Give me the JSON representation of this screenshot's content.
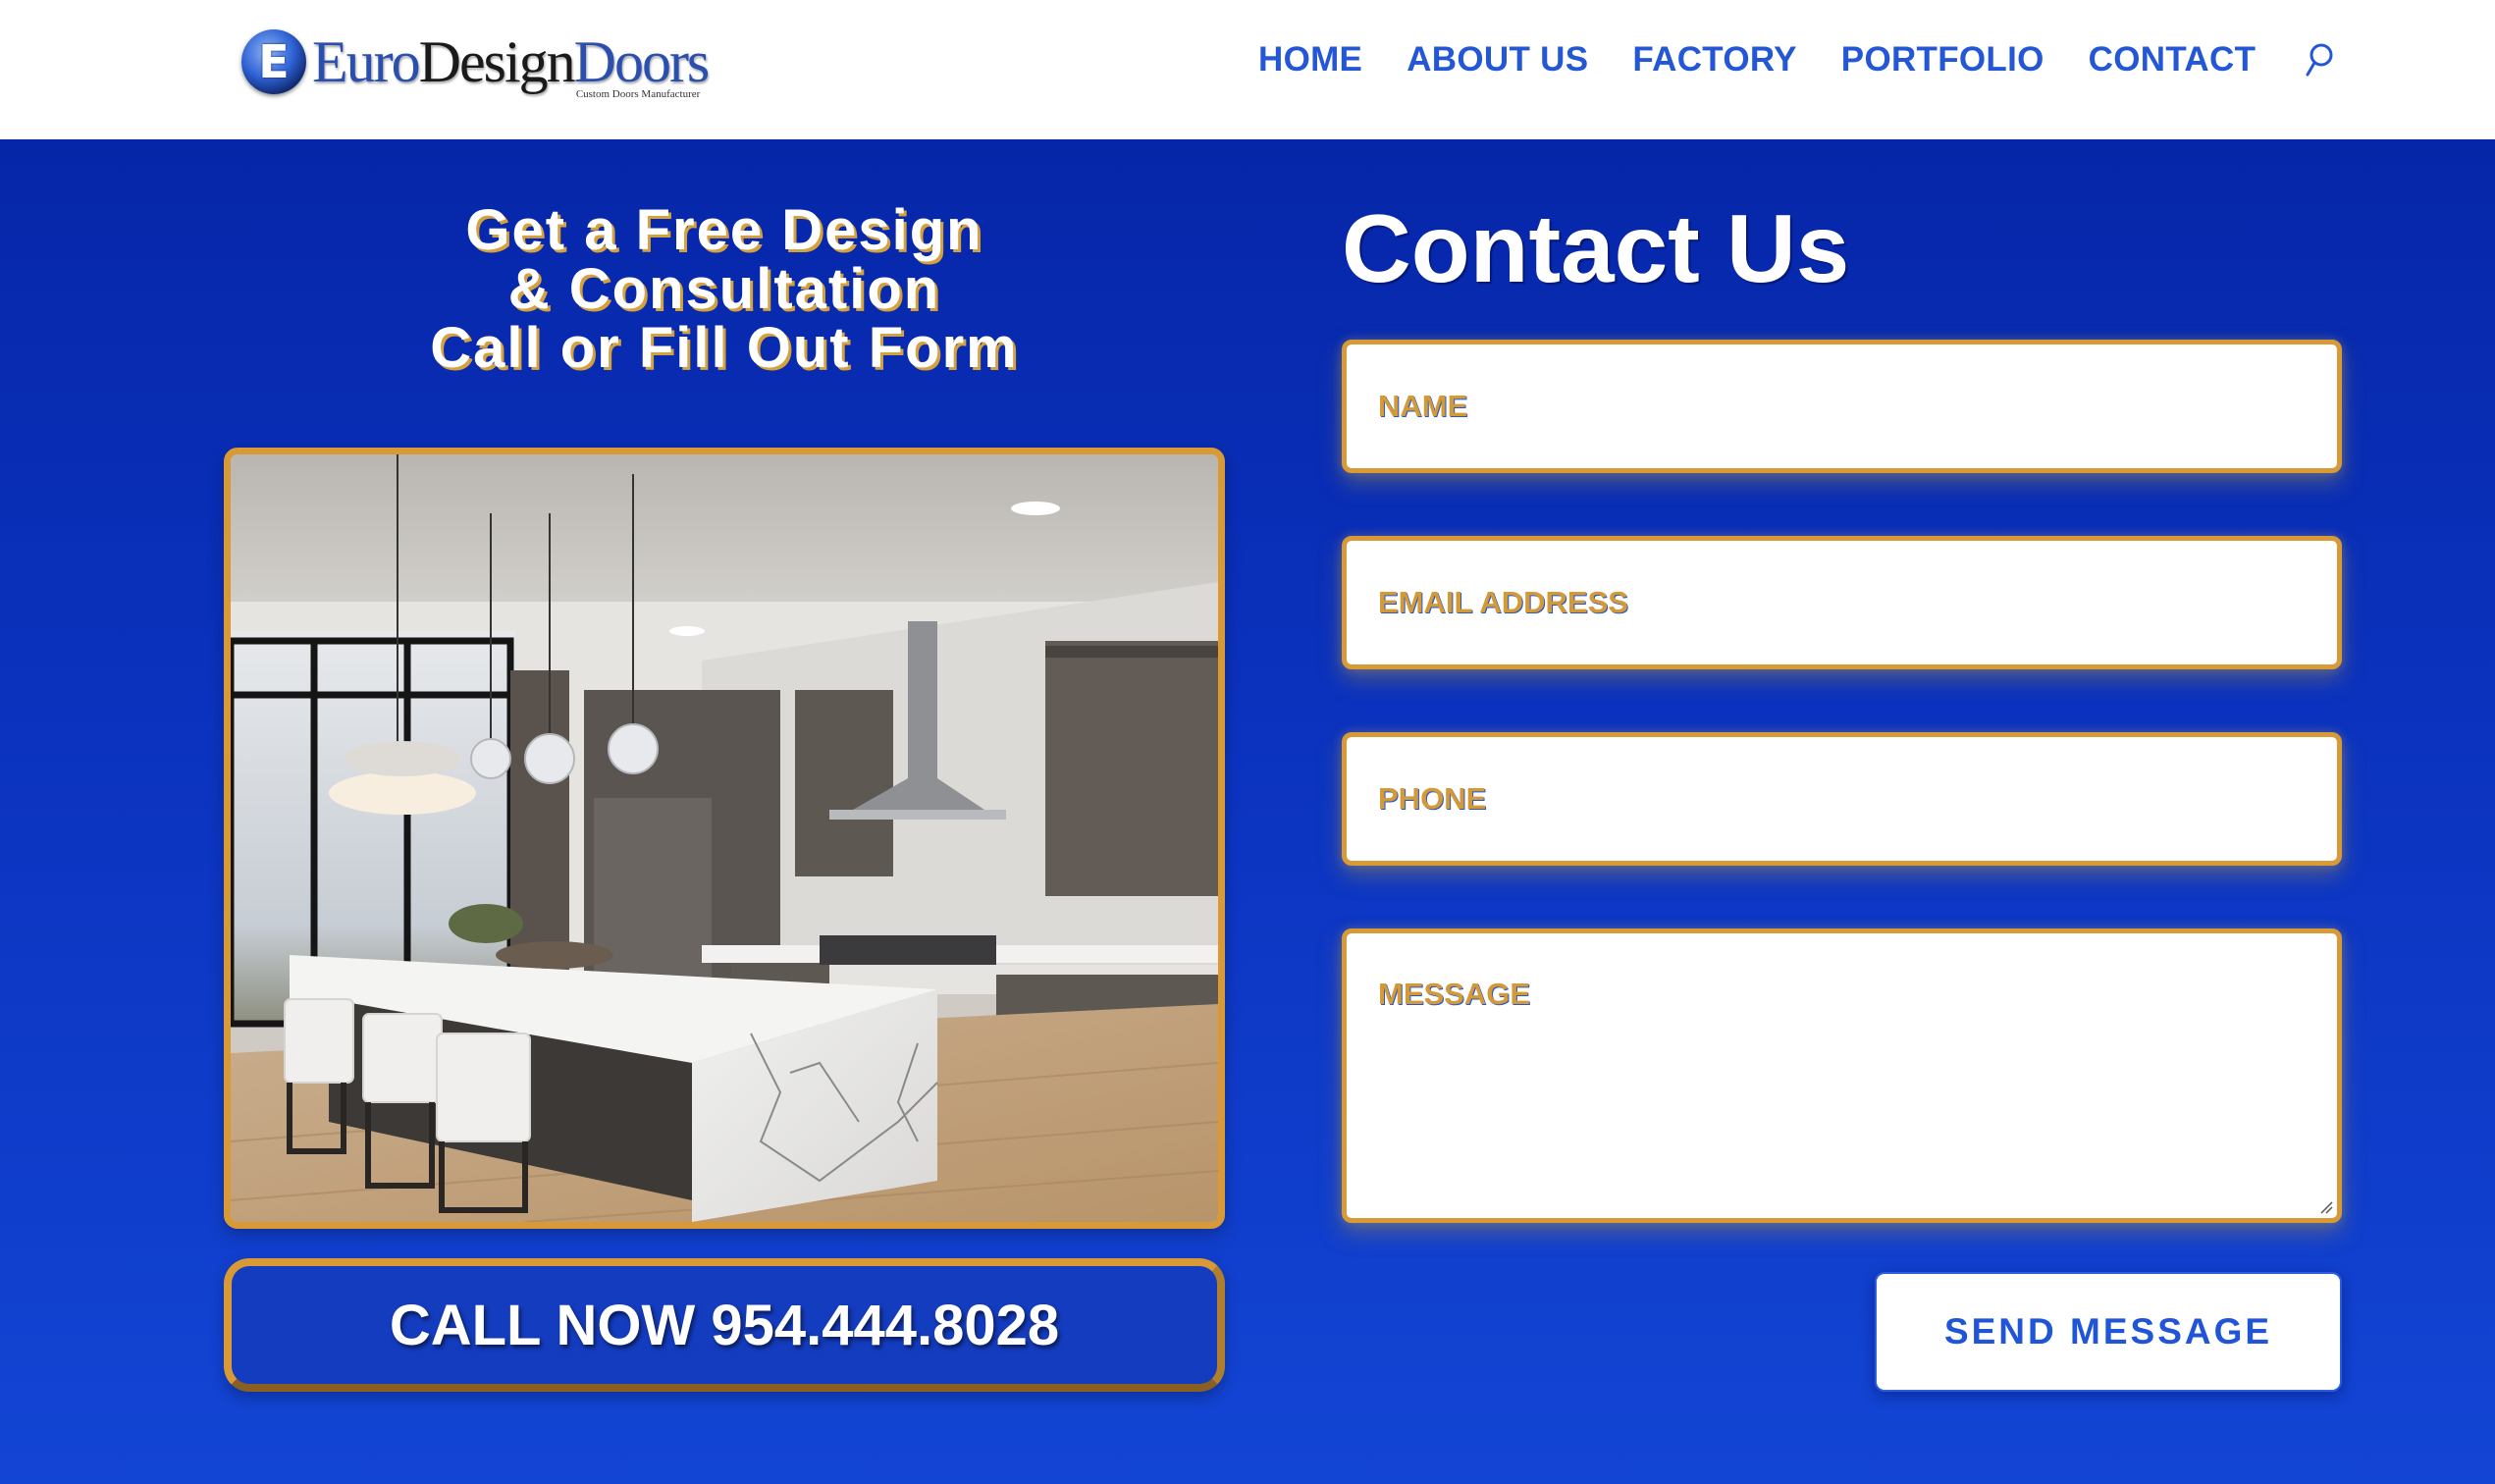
{
  "header": {
    "logo": {
      "badge_letter": "E",
      "word1": "Euro",
      "word2": "Design",
      "word3": "Doors",
      "tagline": "Custom Doors Manufacturer"
    },
    "nav": [
      {
        "label": "HOME"
      },
      {
        "label": "ABOUT US"
      },
      {
        "label": "FACTORY"
      },
      {
        "label": "PORTFOLIO"
      },
      {
        "label": "CONTACT"
      }
    ],
    "search_icon": "search-icon"
  },
  "promo": {
    "heading_lines": [
      "Get a Free Design",
      "& Consultation",
      "Call or Fill Out Form"
    ],
    "image_alt": "Modern kitchen with marble waterfall island, white bar stools, pendant lights and dark cabinets",
    "call_button": "CALL NOW 954.444.8028"
  },
  "contact": {
    "title": "Contact Us",
    "fields": {
      "name": {
        "placeholder": "NAME",
        "value": ""
      },
      "email": {
        "placeholder": "EMAIL ADDRESS",
        "value": ""
      },
      "phone": {
        "placeholder": "PHONE",
        "value": ""
      },
      "message": {
        "placeholder": "MESSAGE",
        "value": ""
      }
    },
    "submit_label": "SEND MESSAGE"
  },
  "colors": {
    "brand_blue": "#2457d6",
    "section_blue_top": "#0626a8",
    "section_blue_bottom": "#1345d4",
    "gold_accent": "#d89a36"
  }
}
